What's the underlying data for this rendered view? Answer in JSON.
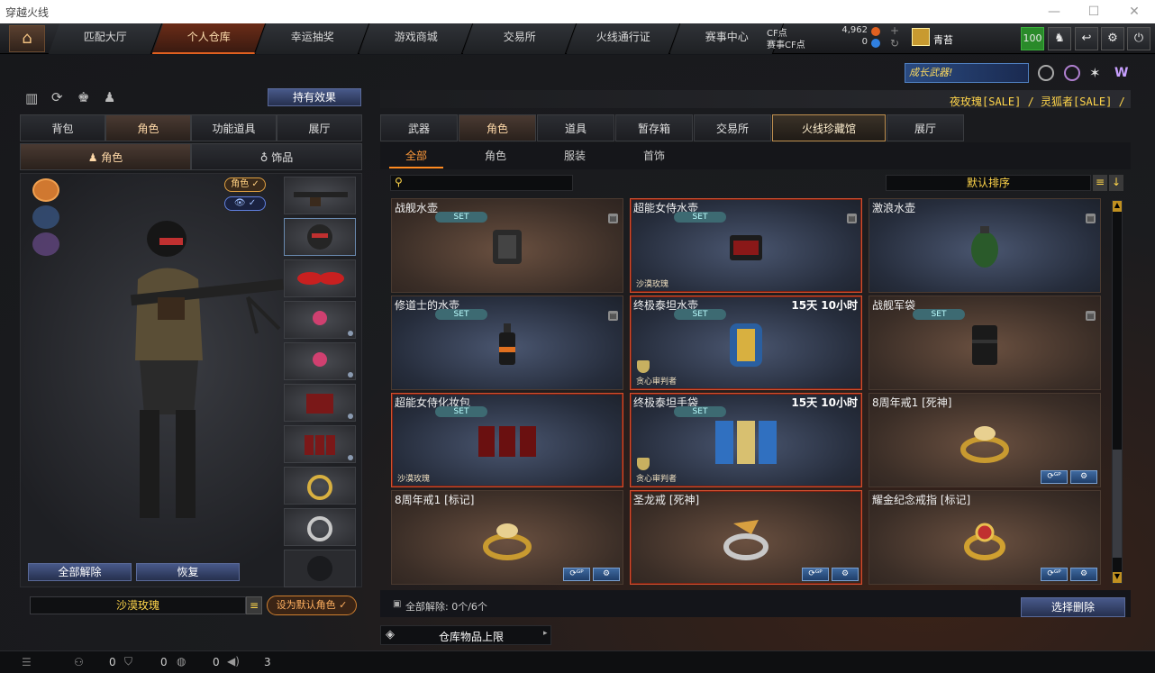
{
  "window": {
    "title": "穿越火线"
  },
  "nav": {
    "tabs": [
      "匹配大厅",
      "个人仓库",
      "幸运抽奖",
      "游戏商城",
      "交易所",
      "火线通行证",
      "赛事中心"
    ],
    "active_index": 1
  },
  "currency": {
    "cf_label": "CF点",
    "cf_value": "4,962",
    "match_label": "赛事CF点",
    "match_value": "0"
  },
  "user": {
    "name": "青苔",
    "level": "100"
  },
  "promo": {
    "banner_text": "成长武器!",
    "sale_text": "夜玫瑰[SALE] / 灵狐者[SALE] /"
  },
  "left": {
    "hold_effect_label": "持有效果",
    "tabs": [
      "背包",
      "角色",
      "功能道具",
      "展厅"
    ],
    "active_tab": 1,
    "subtabs": [
      "角色",
      "饰品"
    ],
    "active_subtab": 0,
    "char_badge": "角色",
    "unequip_all": "全部解除",
    "restore": "恢复",
    "character_name": "沙漠玫瑰",
    "set_default": "设为默认角色"
  },
  "right": {
    "tabs": [
      "武器",
      "角色",
      "道具",
      "暂存箱",
      "交易所",
      "火线珍藏馆",
      "展厅"
    ],
    "active_tab": 5,
    "subtabs": [
      "全部",
      "角色",
      "服装",
      "首饰"
    ],
    "active_subtab": 0,
    "search_placeholder": "",
    "sort_label": "默认排序",
    "items": [
      {
        "name": "战舰水壶",
        "time": "",
        "set": "SET",
        "tag": "",
        "style": "brown",
        "icon": "canteen-icon",
        "lock": true,
        "actions": false,
        "selected": false
      },
      {
        "name": "超能女侍水壶",
        "time": "",
        "set": "SET",
        "tag": "沙漠玫瑰",
        "style": "blue",
        "icon": "red-canteen-icon",
        "lock": true,
        "actions": false,
        "selected": true
      },
      {
        "name": "激浪水壶",
        "time": "",
        "set": "",
        "tag": "",
        "style": "blue",
        "icon": "green-canteen-icon",
        "lock": true,
        "actions": false,
        "selected": false
      },
      {
        "name": "修道士的水壶",
        "time": "",
        "set": "SET",
        "tag": "",
        "style": "blue",
        "icon": "bottle-icon",
        "lock": true,
        "actions": false,
        "selected": false
      },
      {
        "name": "终极泰坦水壶",
        "time": "15天 10小时",
        "set": "SET",
        "tag": "贪心审判者",
        "style": "blue",
        "icon": "titan-canteen-icon",
        "lock": false,
        "actions": false,
        "selected": true
      },
      {
        "name": "战舰军袋",
        "time": "",
        "set": "SET",
        "tag": "",
        "style": "brown",
        "icon": "pouch-icon",
        "lock": true,
        "actions": false,
        "selected": false
      },
      {
        "name": "超能女侍化妆包",
        "time": "",
        "set": "SET",
        "tag": "沙漠玫瑰",
        "style": "blue",
        "icon": "makeup-bag-icon",
        "lock": false,
        "actions": false,
        "selected": true
      },
      {
        "name": "终极泰坦手袋",
        "time": "15天 10小时",
        "set": "SET",
        "tag": "贪心审判者",
        "style": "blue",
        "icon": "titan-bag-icon",
        "lock": false,
        "actions": false,
        "selected": true
      },
      {
        "name": "8周年戒1 [死神]",
        "time": "",
        "set": "",
        "tag": "",
        "style": "brown",
        "icon": "ring-icon",
        "lock": false,
        "actions": true,
        "selected": false
      },
      {
        "name": "8周年戒1 [标记]",
        "time": "",
        "set": "",
        "tag": "",
        "style": "brown",
        "icon": "ring-icon",
        "lock": false,
        "actions": true,
        "selected": false
      },
      {
        "name": "圣龙戒 [死神]",
        "time": "",
        "set": "",
        "tag": "",
        "style": "brown",
        "icon": "dragon-ring-icon",
        "lock": false,
        "actions": true,
        "selected": true
      },
      {
        "name": "耀金纪念戒指 [标记]",
        "time": "",
        "set": "",
        "tag": "",
        "style": "brown",
        "icon": "gold-ring-icon",
        "lock": false,
        "actions": true,
        "selected": false
      }
    ],
    "unequip_status": "全部解除: 0个/6个",
    "select_delete": "选择删除",
    "capacity_label": "仓库物品上限"
  },
  "status": {
    "val1": "0",
    "val2": "0",
    "val3": "0",
    "val4": "3"
  }
}
